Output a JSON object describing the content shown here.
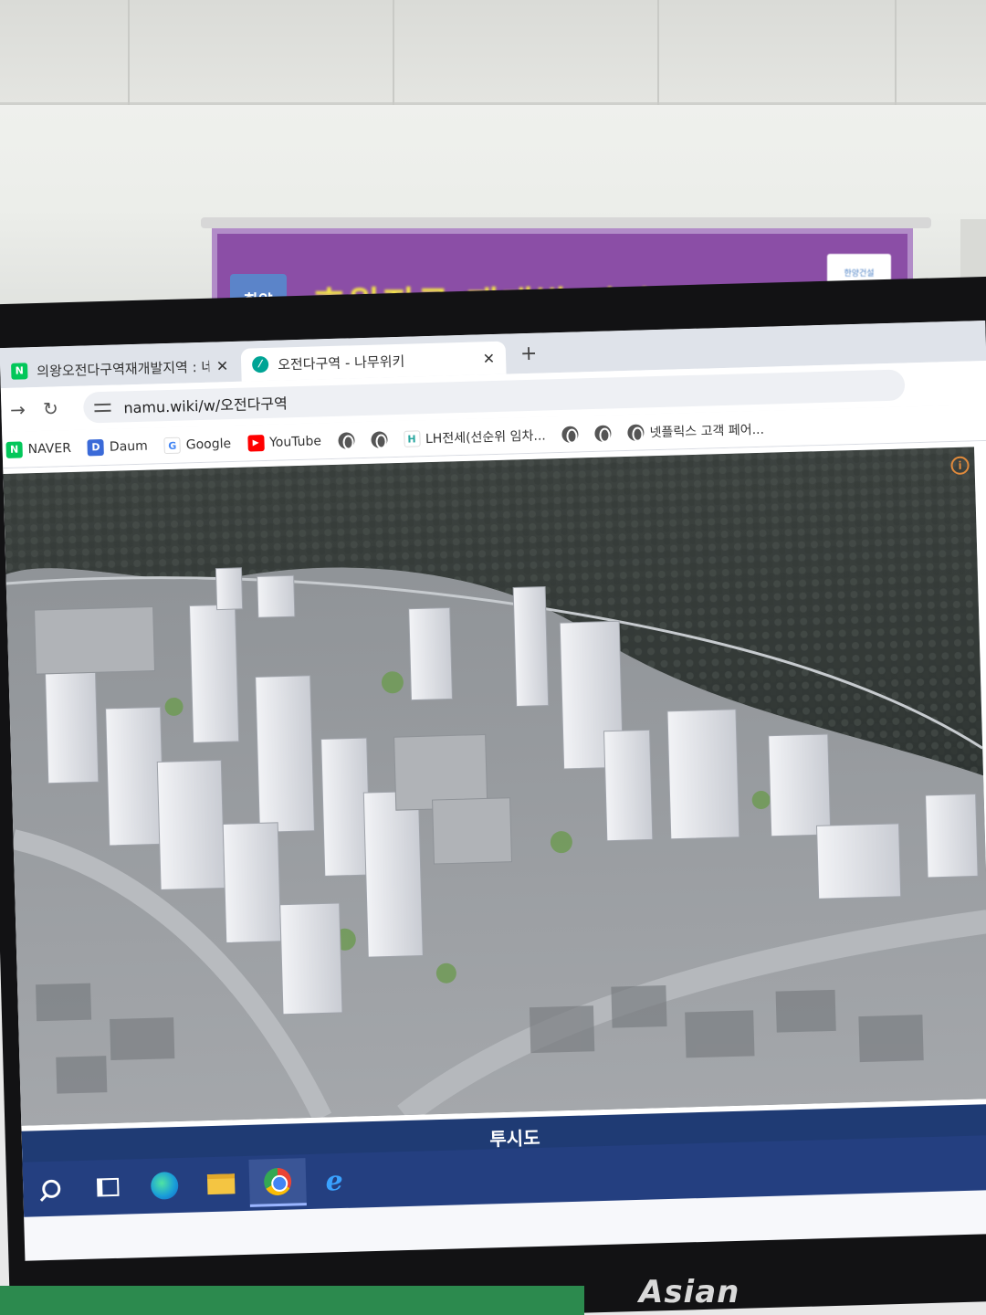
{
  "banner": {
    "left_box": "한양",
    "text": "호원지구 재개발 아파트 조감도",
    "logo": "한양건설"
  },
  "browser": {
    "tabs": [
      {
        "label": "의왕오전다구역재개발지역 : 네",
        "favicon": "naver-icon",
        "active": false
      },
      {
        "label": "오전다구역 - 나무위키",
        "favicon": "namuwiki-icon",
        "active": true
      }
    ],
    "url": "namu.wiki/w/오전다구역",
    "bookmarks": [
      {
        "label": "NAVER",
        "icon": "naver-icon",
        "color": "#03c75a",
        "glyph": "N"
      },
      {
        "label": "Daum",
        "icon": "daum-icon",
        "color": "#3a6ad8",
        "glyph": "D"
      },
      {
        "label": "Google",
        "icon": "google-icon",
        "color": "#4285f4",
        "glyph": "G"
      },
      {
        "label": "YouTube",
        "icon": "youtube-icon",
        "color": "#ff0000",
        "glyph": "▶"
      }
    ],
    "bookmarks_more": [
      {
        "label": "LH전세(선순위 임차...",
        "icon": "lh-icon"
      },
      {
        "label": "넷플릭스 고객 페어...",
        "icon": "globe-icon"
      }
    ]
  },
  "page": {
    "figure_caption": "투시도"
  },
  "monitor": {
    "brand": "Asian"
  },
  "colors": {
    "caption_bar": "#1f3b74",
    "taskbar": "#243f80",
    "banner": "#8b4ea6",
    "banner_text": "#f3e548"
  }
}
